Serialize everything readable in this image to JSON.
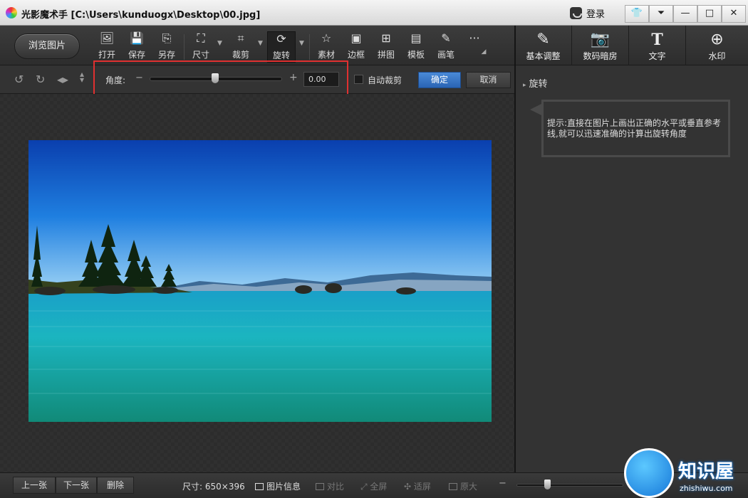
{
  "app": {
    "title": "光影魔术手  [C:\\Users\\kunduogx\\Desktop\\00.jpg]",
    "login": "登录",
    "window_buttons": [
      "skin-icon",
      "menu-icon",
      "minimize-icon",
      "maximize-icon",
      "close-icon"
    ]
  },
  "toolbar": {
    "browse": "浏览图片",
    "tools": [
      {
        "label": "打开",
        "icon": "open-icon"
      },
      {
        "label": "保存",
        "icon": "save-icon"
      },
      {
        "label": "另存",
        "icon": "save-as-icon"
      },
      {
        "label": "尺寸",
        "icon": "resize-icon"
      },
      {
        "label": "裁剪",
        "icon": "crop-icon"
      },
      {
        "label": "旋转",
        "icon": "rotate-icon"
      },
      {
        "label": "素材",
        "icon": "material-icon"
      },
      {
        "label": "边框",
        "icon": "border-icon"
      },
      {
        "label": "拼图",
        "icon": "collage-icon"
      },
      {
        "label": "模板",
        "icon": "template-icon"
      },
      {
        "label": "画笔",
        "icon": "brush-icon"
      }
    ],
    "big_tools": [
      {
        "label": "基本调整",
        "icon": "adjust-icon"
      },
      {
        "label": "数码暗房",
        "icon": "darkroom-icon"
      },
      {
        "label": "文字",
        "icon": "text-icon"
      },
      {
        "label": "水印",
        "icon": "watermark-icon"
      }
    ]
  },
  "rotate_bar": {
    "angle_label": "角度:",
    "minus": "−",
    "plus": "+",
    "angle_value": "0.00",
    "slider_position": 0.5,
    "auto_crop": "自动裁剪",
    "confirm": "确定",
    "cancel": "取消"
  },
  "right_panel": {
    "heading": "旋转",
    "tip": "提示:直接在图片上画出正确的水平或垂直参考线,就可以迅速准确的计算出旋转角度"
  },
  "bottom": {
    "prev": "上一张",
    "next": "下一张",
    "delete": "删除",
    "size": "尺寸: 650×396",
    "info": "图片信息",
    "compare": "对比",
    "fullscreen": "全屏",
    "fit": "适屏",
    "original": "原大"
  },
  "watermark": {
    "text": "知识屋",
    "sub": "zhishiwu.com"
  }
}
